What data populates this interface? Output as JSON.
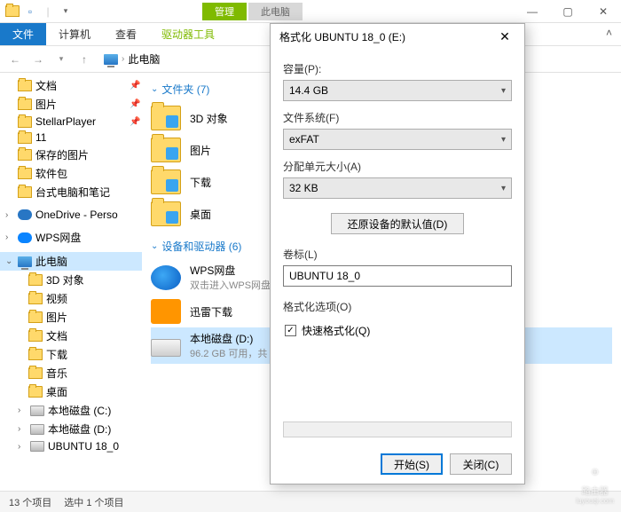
{
  "titlebar": {
    "contextual_tab1": "管理",
    "contextual_tab2": "此电脑"
  },
  "ribbon": {
    "file": "文件",
    "computer": "计算机",
    "view": "查看",
    "drive_tools": "驱动器工具"
  },
  "breadcrumb": {
    "location": "此电脑"
  },
  "sidebar": {
    "items": [
      {
        "label": "文档",
        "icon": "folder",
        "pinned": true
      },
      {
        "label": "图片",
        "icon": "folder",
        "pinned": true
      },
      {
        "label": "StellarPlayer",
        "icon": "folder",
        "pinned": true
      },
      {
        "label": "11",
        "icon": "folder",
        "pinned": false
      },
      {
        "label": "保存的图片",
        "icon": "folder",
        "pinned": false
      },
      {
        "label": "软件包",
        "icon": "folder",
        "pinned": false
      },
      {
        "label": "台式电脑和笔记",
        "icon": "folder",
        "pinned": false
      },
      {
        "label": "OneDrive - Perso",
        "icon": "cloud",
        "pinned": false,
        "top": true
      },
      {
        "label": "WPS网盘",
        "icon": "cloud",
        "pinned": false,
        "top": true
      },
      {
        "label": "此电脑",
        "icon": "pc",
        "selected": true,
        "top": true
      },
      {
        "label": "3D 对象",
        "icon": "folder"
      },
      {
        "label": "视频",
        "icon": "folder"
      },
      {
        "label": "图片",
        "icon": "folder"
      },
      {
        "label": "文档",
        "icon": "folder"
      },
      {
        "label": "下载",
        "icon": "folder"
      },
      {
        "label": "音乐",
        "icon": "folder"
      },
      {
        "label": "桌面",
        "icon": "folder"
      },
      {
        "label": "本地磁盘 (C:)",
        "icon": "disk"
      },
      {
        "label": "本地磁盘 (D:)",
        "icon": "disk"
      },
      {
        "label": "UBUNTU 18_0",
        "icon": "disk"
      }
    ]
  },
  "main": {
    "group_folders": "文件夹 (7)",
    "group_devices": "设备和驱动器 (6)",
    "folders": [
      {
        "label": "3D 对象"
      },
      {
        "label": "图片"
      },
      {
        "label": "下载"
      },
      {
        "label": "桌面"
      }
    ],
    "devices": [
      {
        "label": "WPS网盘",
        "sub": "双击进入WPS网盘",
        "type": "wps"
      },
      {
        "label": "迅雷下载",
        "sub": "",
        "type": "thunder"
      },
      {
        "label": "本地磁盘 (D:)",
        "sub": "96.2 GB 可用，共",
        "type": "drive",
        "selected": true
      }
    ]
  },
  "statusbar": {
    "items": "13 个项目",
    "selection": "选中 1 个项目"
  },
  "dialog": {
    "title": "格式化 UBUNTU 18_0 (E:)",
    "capacity_label": "容量(P):",
    "capacity_value": "14.4 GB",
    "filesystem_label": "文件系统(F)",
    "filesystem_value": "exFAT",
    "allocation_label": "分配单元大小(A)",
    "allocation_value": "32 KB",
    "restore_defaults": "还原设备的默认值(D)",
    "volume_label": "卷标(L)",
    "volume_value": "UBUNTU 18_0",
    "options_label": "格式化选项(O)",
    "quick_format": "快速格式化(Q)",
    "start": "开始(S)",
    "close": "关闭(C)"
  },
  "watermark": {
    "text": "路由器",
    "url": "luyouqi.com"
  }
}
